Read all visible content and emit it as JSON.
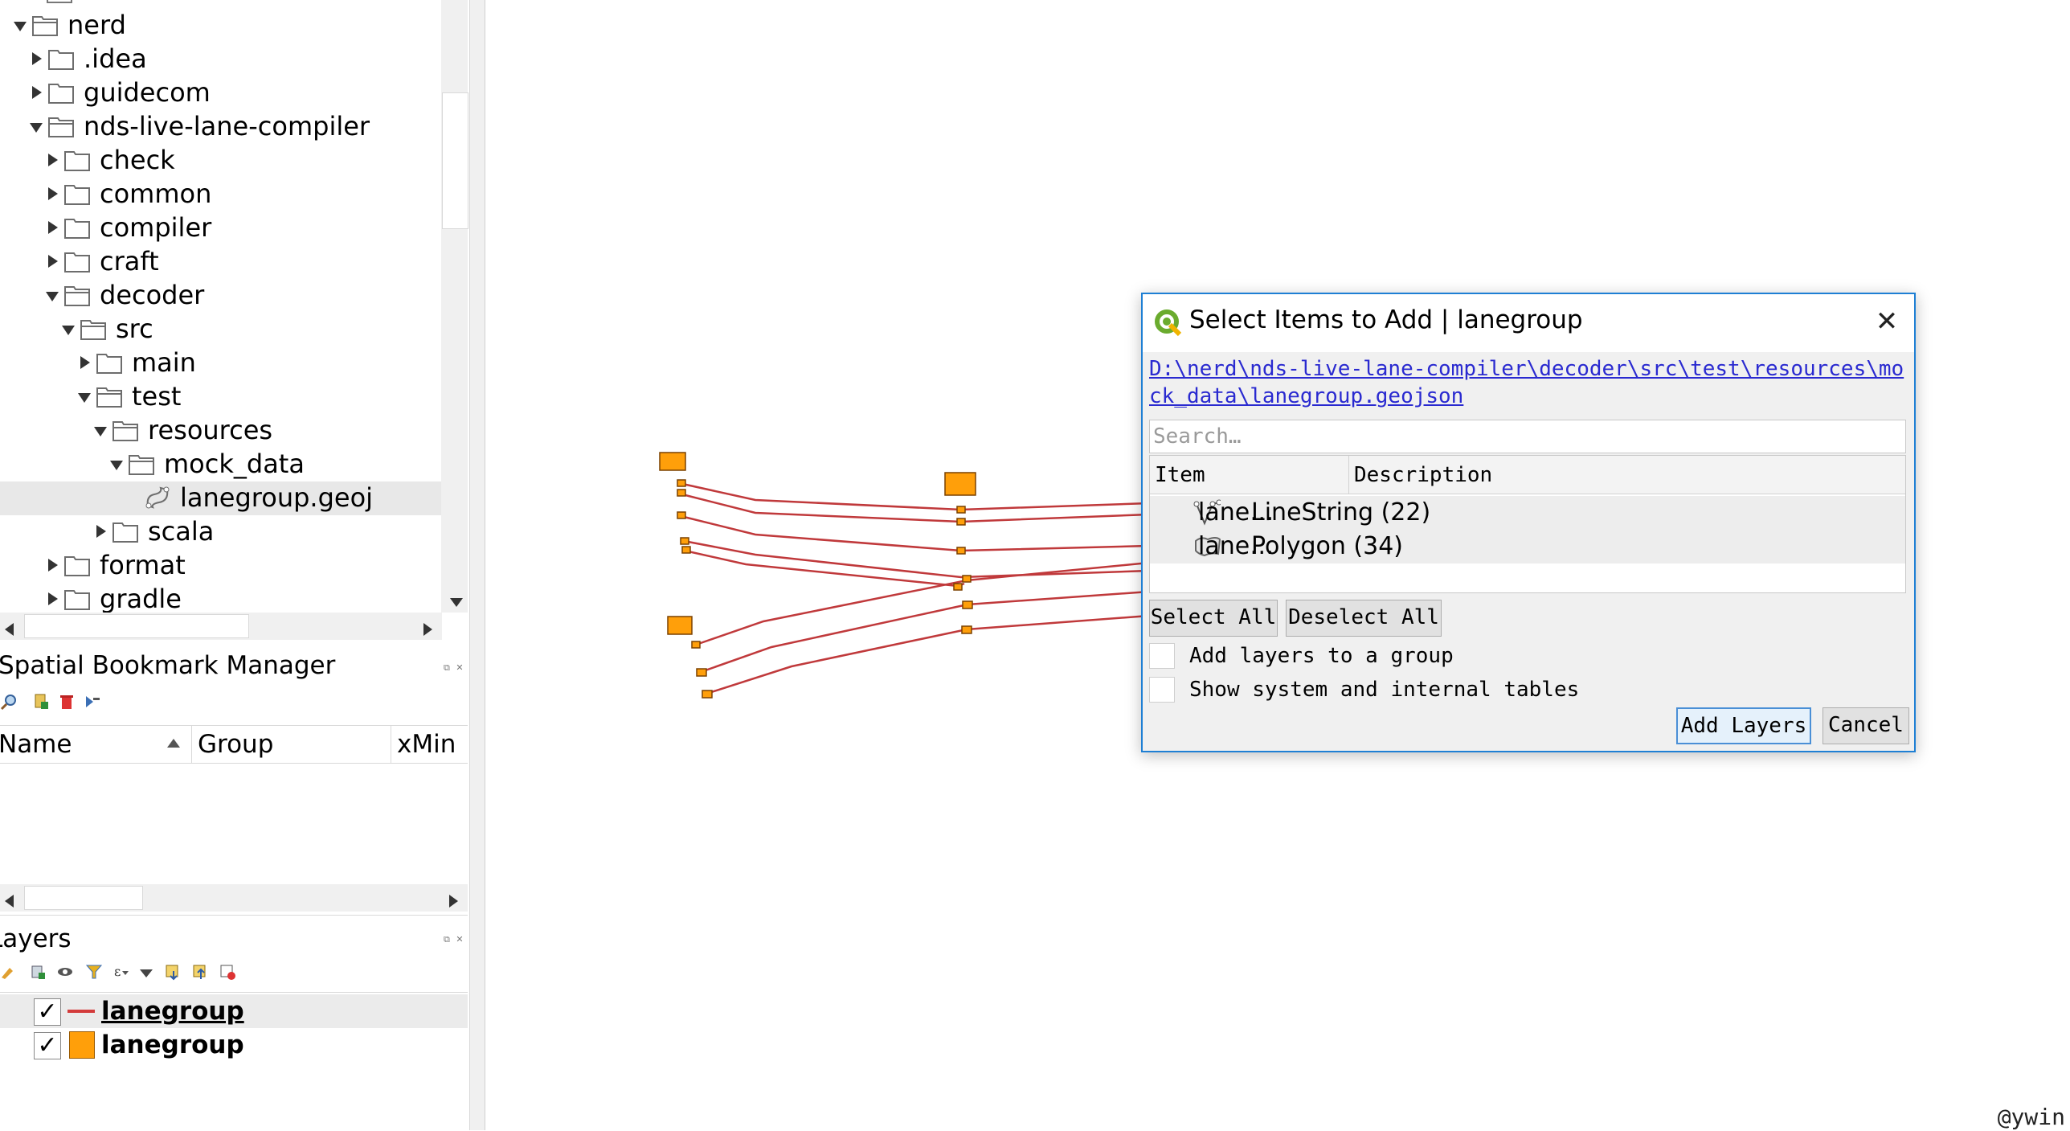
{
  "browser_tree": {
    "items": [
      {
        "label": "nerd",
        "expanded": true
      },
      {
        "label": ".idea",
        "expanded": false
      },
      {
        "label": "guidecom",
        "expanded": false
      },
      {
        "label": "nds-live-lane-compiler",
        "expanded": true
      },
      {
        "label": "check",
        "expanded": false
      },
      {
        "label": "common",
        "expanded": false
      },
      {
        "label": "compiler",
        "expanded": false
      },
      {
        "label": "craft",
        "expanded": false
      },
      {
        "label": "decoder",
        "expanded": true
      },
      {
        "label": "src",
        "expanded": true
      },
      {
        "label": "main",
        "expanded": false
      },
      {
        "label": "test",
        "expanded": true
      },
      {
        "label": "resources",
        "expanded": true
      },
      {
        "label": "mock_data",
        "expanded": true
      },
      {
        "label": "lanegroup.geoj",
        "expanded": null
      },
      {
        "label": "scala",
        "expanded": false
      },
      {
        "label": "format",
        "expanded": false
      },
      {
        "label": "gradle",
        "expanded": false
      }
    ],
    "selected_label": "lanegroup.geoj"
  },
  "bookmark_panel": {
    "title": "Spatial Bookmark Manager",
    "columns": [
      "Name",
      "Group",
      "xMin"
    ]
  },
  "layers_panel": {
    "title": "Layers",
    "layers": [
      {
        "label": "lanegroup",
        "checked": true,
        "symbol": "line",
        "color": "#d33b3b"
      },
      {
        "label": "lanegroup",
        "checked": true,
        "symbol": "fill",
        "color": "#ff9f0a"
      }
    ]
  },
  "dialog": {
    "title": "Select Items to Add | lanegroup",
    "path": "D:\\nerd\\nds-live-lane-compiler\\decoder\\src\\test\\resources\\mock_data\\lanegroup.geojson",
    "search_placeholder": "Search…",
    "columns": [
      "Item",
      "Description"
    ],
    "rows": [
      {
        "item": "lane…",
        "description": "LineString (22)",
        "icon": "linestring-icon"
      },
      {
        "item": "lane…",
        "description": "Polygon (34)",
        "icon": "polygon-icon"
      }
    ],
    "select_all": "Select All",
    "deselect_all": "Deselect All",
    "option_group": "Add layers to a group",
    "option_system": "Show system and internal tables",
    "add_layers": "Add Layers",
    "cancel": "Cancel"
  },
  "map": {
    "line_color": "#c0393b",
    "point_color": "#ff9f0a"
  },
  "watermark": "@ywin"
}
